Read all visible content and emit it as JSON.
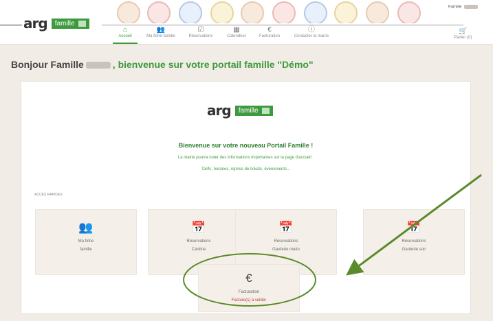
{
  "header": {
    "logo_text": "arg",
    "logo_badge": "famille",
    "user_label": "Famille",
    "nav": [
      {
        "icon": "home-icon",
        "glyph": "⌂",
        "label": "Accueil",
        "active": true
      },
      {
        "icon": "family-icon",
        "glyph": "👥",
        "label": "Ma fiche famille"
      },
      {
        "icon": "calendar-check-icon",
        "glyph": "☑",
        "label": "Réservations"
      },
      {
        "icon": "calendar-icon",
        "glyph": "▦",
        "label": "Calendrier"
      },
      {
        "icon": "euro-icon",
        "glyph": "€",
        "label": "Facturation"
      },
      {
        "icon": "info-icon",
        "glyph": "ⓘ",
        "label": "Contacter la mairie"
      }
    ],
    "cart": {
      "icon": "cart-icon",
      "glyph": "🛒",
      "label": "Panier (0)"
    }
  },
  "greeting": {
    "prefix": "Bonjour Famille",
    "suffix": ", bienvenue sur votre portail famille \"Démo\""
  },
  "card": {
    "logo_text": "arg",
    "logo_badge": "famille",
    "welcome": "Bienvenue sur votre nouveau Portail Famille !",
    "info1": "La mairie pourra noter des informations importantes sur la page d'accueil :",
    "info2": "Tarifs, horaires, reprise de tickets, évènements...",
    "quick_access_label": "ACCÈS RAPIDES",
    "tiles": [
      {
        "icon": "family-icon",
        "glyph": "👥",
        "line1": "Ma fiche",
        "line2": "famille"
      },
      {
        "icon": "calendar-check-icon",
        "glyph": "📅",
        "line1": "Réservations",
        "line2": "Cantine"
      },
      {
        "icon": "calendar-check-icon",
        "glyph": "📅",
        "line1": "Réservations",
        "line2": "Garderie matin"
      },
      {
        "icon": "calendar-check-icon",
        "glyph": "📅",
        "line1": "Réservations",
        "line2": "Garderie soir"
      },
      {
        "icon": "euro-icon",
        "glyph": "€",
        "line1": "Facturation",
        "line2": "Facture(s) à solder"
      }
    ]
  },
  "colors": {
    "brand_green": "#3e9a3e",
    "annotation_green": "#5b8a2a",
    "alert_red": "#c0392b",
    "page_bg": "#f1ede6"
  }
}
